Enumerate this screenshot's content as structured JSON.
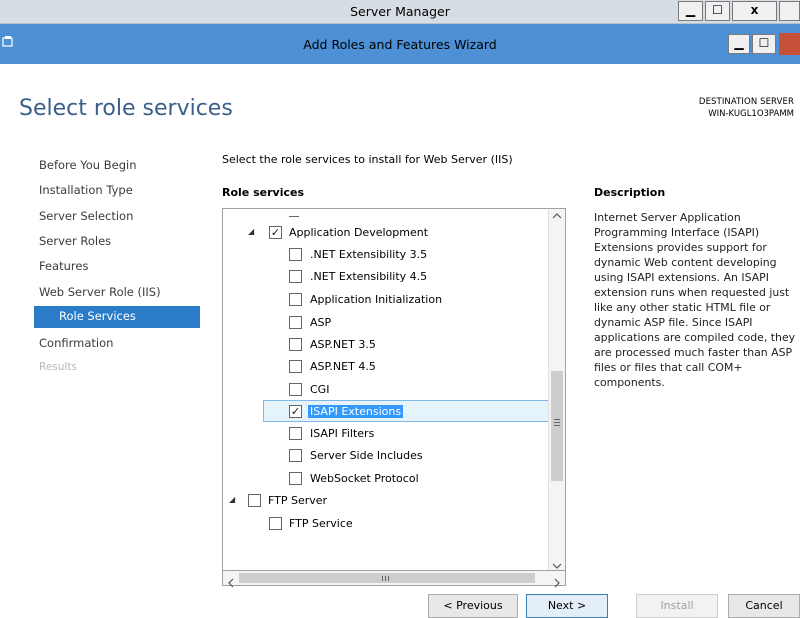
{
  "outer_window": {
    "title": "Server Manager",
    "min_label": "▁",
    "max_label": "☐",
    "close_label": "x"
  },
  "wizard_window": {
    "title": "Add Roles and Features Wizard",
    "min_label": "▁",
    "max_label": "☐"
  },
  "header": {
    "page_title": "Select role services",
    "destination_label": "DESTINATION SERVER",
    "destination_server": "WIN-KUGL1O3PAMM"
  },
  "nav": {
    "items": [
      {
        "label": "Before You Begin"
      },
      {
        "label": "Installation Type"
      },
      {
        "label": "Server Selection"
      },
      {
        "label": "Server Roles"
      },
      {
        "label": "Features"
      },
      {
        "label": "Web Server Role (IIS)"
      },
      {
        "label": "Role Services"
      },
      {
        "label": "Confirmation"
      },
      {
        "label": "Results"
      }
    ],
    "selected_index": 6
  },
  "main": {
    "instruction": "Select the role services to install for Web Server (IIS)",
    "role_services_header": "Role services",
    "tree": [
      {
        "label": "Application Development",
        "checked": true,
        "level": 1,
        "expanded": true
      },
      {
        "label": ".NET Extensibility 3.5",
        "checked": false,
        "level": 2
      },
      {
        "label": ".NET Extensibility 4.5",
        "checked": false,
        "level": 2
      },
      {
        "label": "Application Initialization",
        "checked": false,
        "level": 2
      },
      {
        "label": "ASP",
        "checked": false,
        "level": 2
      },
      {
        "label": "ASP.NET 3.5",
        "checked": false,
        "level": 2
      },
      {
        "label": "ASP.NET 4.5",
        "checked": false,
        "level": 2
      },
      {
        "label": "CGI",
        "checked": false,
        "level": 2
      },
      {
        "label": "ISAPI Extensions",
        "checked": true,
        "level": 2,
        "selected": true
      },
      {
        "label": "ISAPI Filters",
        "checked": false,
        "level": 2
      },
      {
        "label": "Server Side Includes",
        "checked": false,
        "level": 2
      },
      {
        "label": "WebSocket Protocol",
        "checked": false,
        "level": 2
      },
      {
        "label": "FTP Server",
        "checked": false,
        "level": 0,
        "expanded": true
      },
      {
        "label": "FTP Service",
        "checked": false,
        "level": 1
      }
    ],
    "description_header": "Description",
    "description_text": "Internet Server Application Programming Interface (ISAPI) Extensions provides support for dynamic Web content developing using ISAPI extensions. An ISAPI extension runs when requested just like any other static HTML file or dynamic ASP file. Since ISAPI applications are compiled code, they are processed much faster than ASP files or files that call COM+ components."
  },
  "buttons": {
    "previous": "< Previous",
    "next": "Next >",
    "install": "Install",
    "cancel": "Cancel"
  }
}
